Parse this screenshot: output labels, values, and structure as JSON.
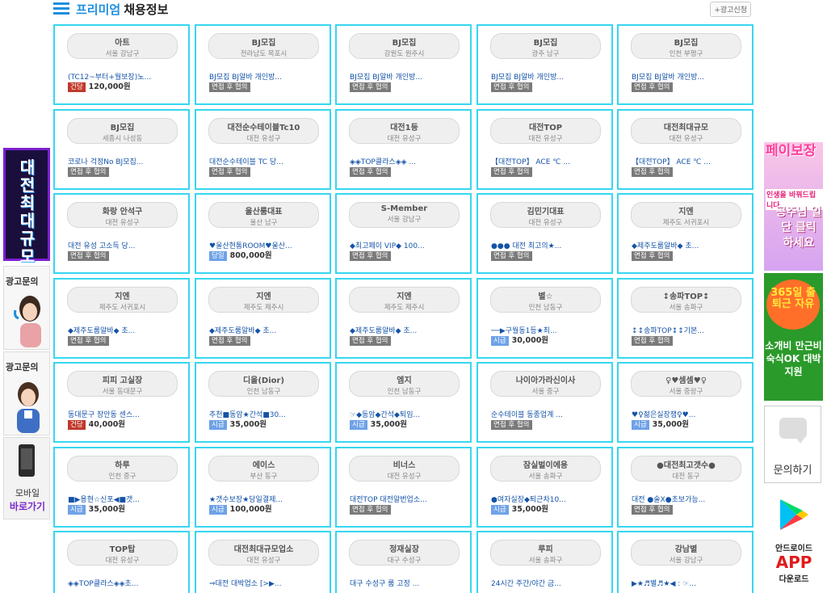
{
  "header": {
    "title_accent": "프리미엄",
    "title_main": "채용정보",
    "ad_apply": "+광고신청"
  },
  "colors": {
    "accent": "#1c8fe0",
    "card_border": "#36d7f0"
  },
  "listings": [
    {
      "business": "아트",
      "location": "서울 강남구",
      "desc": "(TC12~부터+월보장)노...",
      "pay_type": "건당",
      "pay_kind": "per-case",
      "amount": "120,000원"
    },
    {
      "business": "BJ모집",
      "location": "전라남도 목포시",
      "desc": "BJ모집 BJ알바 개인방...",
      "pay_type": "면접 후 협의",
      "pay_kind": "negotiate",
      "amount": ""
    },
    {
      "business": "BJ모집",
      "location": "강원도 원주시",
      "desc": "BJ모집 BJ알바 개인방...",
      "pay_type": "면접 후 협의",
      "pay_kind": "negotiate",
      "amount": ""
    },
    {
      "business": "BJ모집",
      "location": "광주 남구",
      "desc": "BJ모집 BJ알바 개인방...",
      "pay_type": "면접 후 협의",
      "pay_kind": "negotiate",
      "amount": ""
    },
    {
      "business": "BJ모집",
      "location": "인천 부평구",
      "desc": "BJ모집 BJ알바 개인방...",
      "pay_type": "면접 후 협의",
      "pay_kind": "negotiate",
      "amount": ""
    },
    {
      "business": "BJ모집",
      "location": "세종시 나성동",
      "desc": "코로나 걱정No BJ모집...",
      "pay_type": "면접 후 협의",
      "pay_kind": "negotiate",
      "amount": ""
    },
    {
      "business": "대전순수테이블Tc10",
      "location": "대전 유성구",
      "desc": "대전순수테이블 TC 당...",
      "pay_type": "면접 후 협의",
      "pay_kind": "negotiate",
      "amount": ""
    },
    {
      "business": "대전1등",
      "location": "대전 유성구",
      "desc": "◈◈TOP클라스◈◈ ...",
      "pay_type": "면접 후 협의",
      "pay_kind": "negotiate",
      "amount": ""
    },
    {
      "business": "대전TOP",
      "location": "대전 유성구",
      "desc": "【대전TOP】 ACE ℃ ...",
      "pay_type": "면접 후 협의",
      "pay_kind": "negotiate",
      "amount": ""
    },
    {
      "business": "대전최대규모",
      "location": "대전 유성구",
      "desc": "【대전TOP】 ACE ℃ ...",
      "pay_type": "면접 후 협의",
      "pay_kind": "negotiate",
      "amount": ""
    },
    {
      "business": "화랑 안석구",
      "location": "대전 유성구",
      "desc": "대전 유성 고소득 당...",
      "pay_type": "면접 후 협의",
      "pay_kind": "negotiate",
      "amount": ""
    },
    {
      "business": "울산룸대표",
      "location": "울산 남구",
      "desc": "♥울산현통ROOM♥울산...",
      "pay_type": "당일",
      "pay_kind": "daily",
      "amount": "800,000원"
    },
    {
      "business": "S-Member",
      "location": "서울 강남구",
      "desc": "◆최고페이 VIP◆ 100...",
      "pay_type": "면접 후 협의",
      "pay_kind": "negotiate",
      "amount": ""
    },
    {
      "business": "김민기대표",
      "location": "대전 유성구",
      "desc": "●●● 대전 최고의★...",
      "pay_type": "면접 후 협의",
      "pay_kind": "negotiate",
      "amount": ""
    },
    {
      "business": "지엔",
      "location": "제주도 서귀포시",
      "desc": "◆제주도룸알바◆ 초...",
      "pay_type": "면접 후 협의",
      "pay_kind": "negotiate",
      "amount": ""
    },
    {
      "business": "지엔",
      "location": "제주도 서귀포시",
      "desc": "◆제주도룸알바◆ 초...",
      "pay_type": "면접 후 협의",
      "pay_kind": "negotiate",
      "amount": ""
    },
    {
      "business": "지엔",
      "location": "제주도 제주시",
      "desc": "◆제주도룸알바◆ 초...",
      "pay_type": "면접 후 협의",
      "pay_kind": "negotiate",
      "amount": ""
    },
    {
      "business": "지엔",
      "location": "제주도 제주시",
      "desc": "◆제주도룸알바◆ 초...",
      "pay_type": "면접 후 협의",
      "pay_kind": "negotiate",
      "amount": ""
    },
    {
      "business": "별☆",
      "location": "인천 남동구",
      "desc": "──▶구월동1등★최...",
      "pay_type": "시급",
      "pay_kind": "hourly",
      "amount": "30,000원"
    },
    {
      "business": "↕송파TOP↕",
      "location": "서울 송파구",
      "desc": "↕↕송파TOP↕↕기본...",
      "pay_type": "면접 후 협의",
      "pay_kind": "negotiate",
      "amount": ""
    },
    {
      "business": "피피 고실장",
      "location": "서울 동대문구",
      "desc": "동대문구 장안동 센스...",
      "pay_type": "건당",
      "pay_kind": "per-case",
      "amount": "40,000원"
    },
    {
      "business": "디올(Dior)",
      "location": "인천 남동구",
      "desc": "추천■동암★간석■30...",
      "pay_type": "시급",
      "pay_kind": "hourly",
      "amount": "35,000원"
    },
    {
      "business": "엠지",
      "location": "인천 남동구",
      "desc": "☞◆동암◆간석◆퇴임...",
      "pay_type": "시급",
      "pay_kind": "hourly",
      "amount": "35,000원"
    },
    {
      "business": "나이아가라신이사",
      "location": "서울 중구",
      "desc": "순수테이블 동종업계 ...",
      "pay_type": "면접 후 협의",
      "pay_kind": "negotiate",
      "amount": ""
    },
    {
      "business": "♀♥셈셈♥♀",
      "location": "서울 중랑구",
      "desc": "♥♀젊은실장잼♀♥...",
      "pay_type": "시급",
      "pay_kind": "hourly",
      "amount": "35,000원"
    },
    {
      "business": "하루",
      "location": "인천 중구",
      "desc": "■▶용현☆신포◀■갯...",
      "pay_type": "시급",
      "pay_kind": "hourly",
      "amount": "35,000원"
    },
    {
      "business": "에이스",
      "location": "부산 동구",
      "desc": "★갯수보장★당일결제...",
      "pay_type": "시급",
      "pay_kind": "hourly",
      "amount": "100,000원"
    },
    {
      "business": "비너스",
      "location": "대전 유성구",
      "desc": "대전TOP 대전알번업소...",
      "pay_type": "면접 후 협의",
      "pay_kind": "negotiate",
      "amount": ""
    },
    {
      "business": "잠실벌이에용",
      "location": "서울 송파구",
      "desc": "●여자실장◆퇴근차10...",
      "pay_type": "시급",
      "pay_kind": "hourly",
      "amount": "35,000원"
    },
    {
      "business": "●대전최고갯수●",
      "location": "대전 동구",
      "desc": "대전 ●술X●초보가능...",
      "pay_type": "면접 후 협의",
      "pay_kind": "negotiate",
      "amount": ""
    },
    {
      "business": "TOP탑",
      "location": "대전 유성구",
      "desc": "◈◈TOP클라스◈◈초...",
      "pay_type": "",
      "pay_kind": "negotiate",
      "amount": ""
    },
    {
      "business": "대전최대규모업소",
      "location": "대전 유성구",
      "desc": "⇒대전 대박업소 [>▶...",
      "pay_type": "",
      "pay_kind": "negotiate",
      "amount": ""
    },
    {
      "business": "정재실장",
      "location": "대구 수성구",
      "desc": "대구 수성구 룸 고정 ...",
      "pay_type": "",
      "pay_kind": "negotiate",
      "amount": ""
    },
    {
      "business": "루피",
      "location": "서울 송파구",
      "desc": "24시간 주간/야간 금...",
      "pay_type": "",
      "pay_kind": "negotiate",
      "amount": ""
    },
    {
      "business": "강남별",
      "location": "서울 강남구",
      "desc": "▶★♬별♬★◀ : ☞...",
      "pay_type": "",
      "pay_kind": "negotiate",
      "amount": ""
    }
  ],
  "left_banners": {
    "banner1_text": "대전최대규모",
    "ad_inquiry_1": "광고문의",
    "ad_inquiry_2": "광고문의",
    "mobile_1": "모바일",
    "mobile_2": "바로가기"
  },
  "right_banners": {
    "banner1_big": "페이보장",
    "banner1_sub": "인생을 바꿔드립니다",
    "banner1_cta": "공주님 일단 클릭 하세요",
    "banner2_top": "365일 출퇴근 자유",
    "banner2_lines": "소개비 만근비 숙식OK 대박 지원",
    "inquiry": "문의하기",
    "android": "안드로이드",
    "app": "APP",
    "download": "다운로드"
  }
}
